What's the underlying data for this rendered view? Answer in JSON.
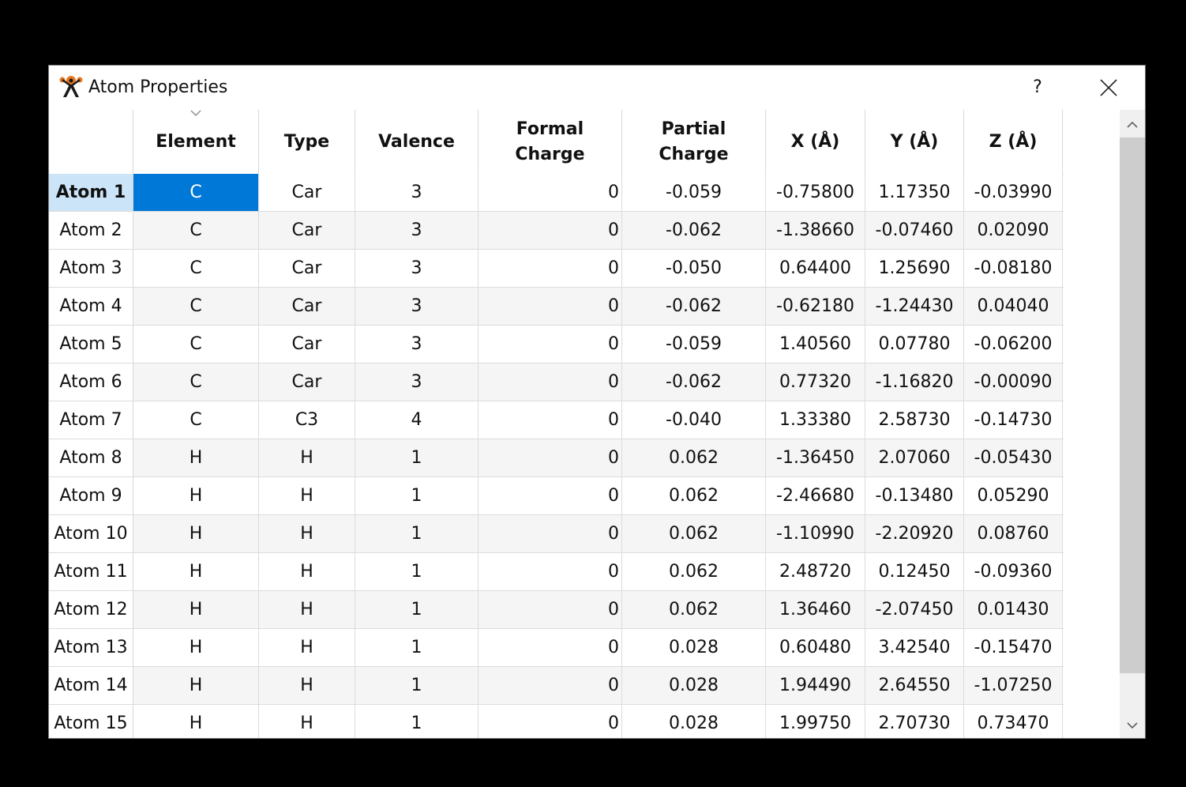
{
  "window": {
    "title": "Atom Properties",
    "help_label": "?",
    "accent_color": "#0078d7",
    "selected_row_color": "#cce4f7"
  },
  "columns": [
    {
      "label": "Element",
      "align": "center"
    },
    {
      "label": "Type",
      "align": "center"
    },
    {
      "label": "Valence",
      "align": "center"
    },
    {
      "label": "Formal\nCharge",
      "align": "right"
    },
    {
      "label": "Partial\nCharge",
      "align": "center"
    },
    {
      "label": "X (Å)",
      "align": "center"
    },
    {
      "label": "Y (Å)",
      "align": "center"
    },
    {
      "label": "Z (Å)",
      "align": "center"
    }
  ],
  "selected": {
    "row": 0,
    "col": 0
  },
  "rows": [
    {
      "label": "Atom 1",
      "cells": [
        "C",
        "Car",
        "3",
        "0",
        "-0.059",
        "-0.75800",
        "1.17350",
        "-0.03990"
      ]
    },
    {
      "label": "Atom 2",
      "cells": [
        "C",
        "Car",
        "3",
        "0",
        "-0.062",
        "-1.38660",
        "-0.07460",
        "0.02090"
      ]
    },
    {
      "label": "Atom 3",
      "cells": [
        "C",
        "Car",
        "3",
        "0",
        "-0.050",
        "0.64400",
        "1.25690",
        "-0.08180"
      ]
    },
    {
      "label": "Atom 4",
      "cells": [
        "C",
        "Car",
        "3",
        "0",
        "-0.062",
        "-0.62180",
        "-1.24430",
        "0.04040"
      ]
    },
    {
      "label": "Atom 5",
      "cells": [
        "C",
        "Car",
        "3",
        "0",
        "-0.059",
        "1.40560",
        "0.07780",
        "-0.06200"
      ]
    },
    {
      "label": "Atom 6",
      "cells": [
        "C",
        "Car",
        "3",
        "0",
        "-0.062",
        "0.77320",
        "-1.16820",
        "-0.00090"
      ]
    },
    {
      "label": "Atom 7",
      "cells": [
        "C",
        "C3",
        "4",
        "0",
        "-0.040",
        "1.33380",
        "2.58730",
        "-0.14730"
      ]
    },
    {
      "label": "Atom 8",
      "cells": [
        "H",
        "H",
        "1",
        "0",
        "0.062",
        "-1.36450",
        "2.07060",
        "-0.05430"
      ]
    },
    {
      "label": "Atom 9",
      "cells": [
        "H",
        "H",
        "1",
        "0",
        "0.062",
        "-2.46680",
        "-0.13480",
        "0.05290"
      ]
    },
    {
      "label": "Atom 10",
      "cells": [
        "H",
        "H",
        "1",
        "0",
        "0.062",
        "-1.10990",
        "-2.20920",
        "0.08760"
      ]
    },
    {
      "label": "Atom 11",
      "cells": [
        "H",
        "H",
        "1",
        "0",
        "0.062",
        "2.48720",
        "0.12450",
        "-0.09360"
      ]
    },
    {
      "label": "Atom 12",
      "cells": [
        "H",
        "H",
        "1",
        "0",
        "0.062",
        "1.36460",
        "-2.07450",
        "0.01430"
      ]
    },
    {
      "label": "Atom 13",
      "cells": [
        "H",
        "H",
        "1",
        "0",
        "0.028",
        "0.60480",
        "3.42540",
        "-0.15470"
      ]
    },
    {
      "label": "Atom 14",
      "cells": [
        "H",
        "H",
        "1",
        "0",
        "0.028",
        "1.94490",
        "2.64550",
        "-1.07250"
      ]
    },
    {
      "label": "Atom 15",
      "cells": [
        "H",
        "H",
        "1",
        "0",
        "0.028",
        "1.99750",
        "2.70730",
        "0.73470"
      ]
    }
  ]
}
